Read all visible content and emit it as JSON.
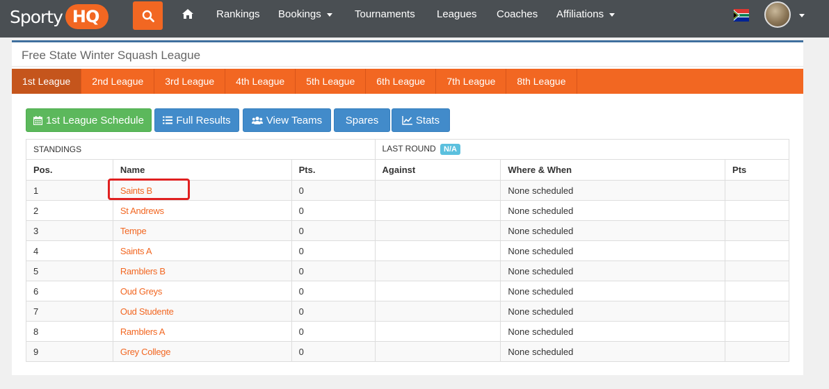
{
  "navbar": {
    "logo_text": "Sporty",
    "logo_badge": "HQ",
    "items": [
      {
        "label": "Rankings"
      },
      {
        "label": "Bookings",
        "dropdown": true
      },
      {
        "label": "Tournaments"
      },
      {
        "label": "Leagues"
      },
      {
        "label": "Coaches"
      },
      {
        "label": "Affiliations",
        "dropdown": true
      }
    ]
  },
  "page": {
    "title": "Free State Winter Squash League"
  },
  "tabs": [
    "1st League",
    "2nd League",
    "3rd League",
    "4th League",
    "5th League",
    "6th League",
    "7th League",
    "8th League"
  ],
  "active_tab": 0,
  "buttons": {
    "schedule": "1st League Schedule",
    "results": "Full Results",
    "teams": "View Teams",
    "spares": "Spares",
    "stats": "Stats"
  },
  "table": {
    "standings_label": "STANDINGS",
    "last_round_label": "LAST ROUND",
    "last_round_badge": "N/A",
    "headers": {
      "pos": "Pos.",
      "name": "Name",
      "pts": "Pts.",
      "against": "Against",
      "where_when": "Where & When",
      "pts2": "Pts"
    },
    "rows": [
      {
        "pos": "1",
        "name": "Saints B",
        "pts": "0",
        "where_when": "None scheduled"
      },
      {
        "pos": "2",
        "name": "St Andrews",
        "pts": "0",
        "where_when": "None scheduled"
      },
      {
        "pos": "3",
        "name": "Tempe",
        "pts": "0",
        "where_when": "None scheduled"
      },
      {
        "pos": "4",
        "name": "Saints A",
        "pts": "0",
        "where_when": "None scheduled"
      },
      {
        "pos": "5",
        "name": "Ramblers B",
        "pts": "0",
        "where_when": "None scheduled"
      },
      {
        "pos": "6",
        "name": "Oud Greys",
        "pts": "0",
        "where_when": "None scheduled"
      },
      {
        "pos": "7",
        "name": "Oud Studente",
        "pts": "0",
        "where_when": "None scheduled"
      },
      {
        "pos": "8",
        "name": "Ramblers A",
        "pts": "0",
        "where_when": "None scheduled"
      },
      {
        "pos": "9",
        "name": "Grey College",
        "pts": "0",
        "where_when": "None scheduled"
      }
    ]
  },
  "colors": {
    "brand_orange": "#f26722",
    "navbar": "#4a4f53",
    "green_button": "#5cb85c",
    "blue_button": "#428bca",
    "highlight": "#e02020"
  }
}
